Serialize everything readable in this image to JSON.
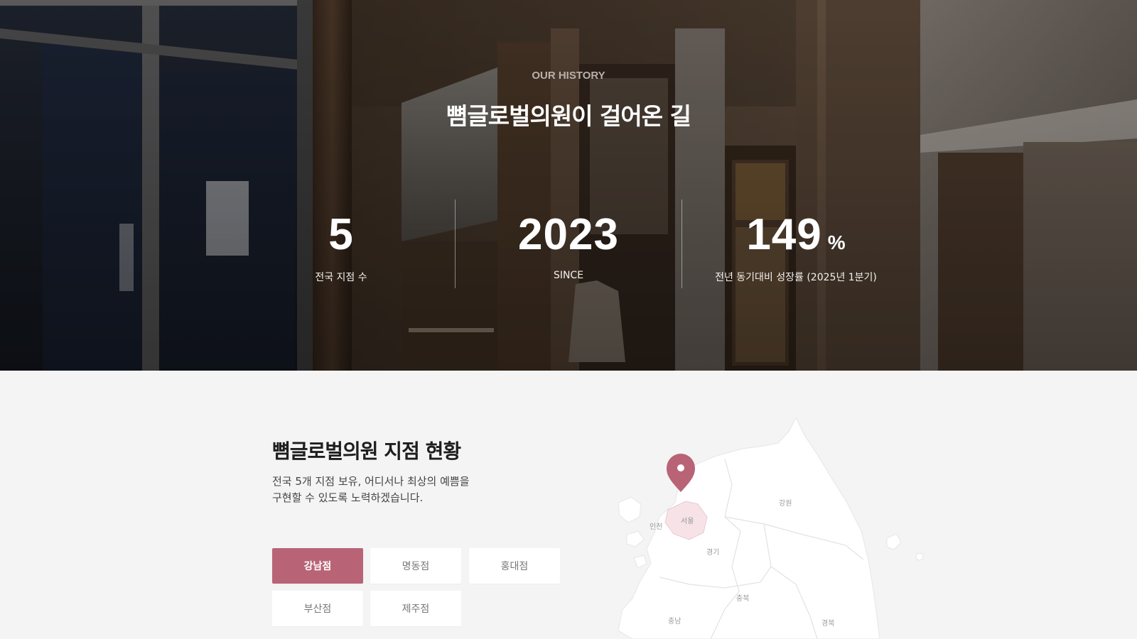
{
  "hero": {
    "eyebrow": "OUR HISTORY",
    "title": "뼘글로벌의원이 걸어온 길",
    "stats": [
      {
        "value": "5",
        "unit": "",
        "label": "전국 지점 수"
      },
      {
        "value": "2023",
        "unit": "",
        "label": "SINCE"
      },
      {
        "value": "149",
        "unit": "%",
        "label": "전년 동기대비 성장률 (2025년 1분기)"
      }
    ]
  },
  "branches": {
    "title": "뼘글로벌의원 지점 현황",
    "description_line1": "전국 5개 지점 보유, 어디서나 최상의 예쁨을",
    "description_line2": "구현할 수 있도록 노력하겠습니다.",
    "buttons": [
      {
        "label": "강남점",
        "active": true
      },
      {
        "label": "명동점",
        "active": false
      },
      {
        "label": "홍대점",
        "active": false
      },
      {
        "label": "부산점",
        "active": false
      },
      {
        "label": "제주점",
        "active": false
      }
    ],
    "map_regions": {
      "seoul": "서울",
      "incheon": "인천",
      "gyeonggi": "경기",
      "gangwon": "강원",
      "chungbuk": "충북",
      "chungnam": "충남",
      "gyeongbuk": "경북"
    }
  },
  "colors": {
    "accent": "#b86476",
    "map_fill": "#ffffff",
    "map_highlight": "#f7e3e7"
  }
}
